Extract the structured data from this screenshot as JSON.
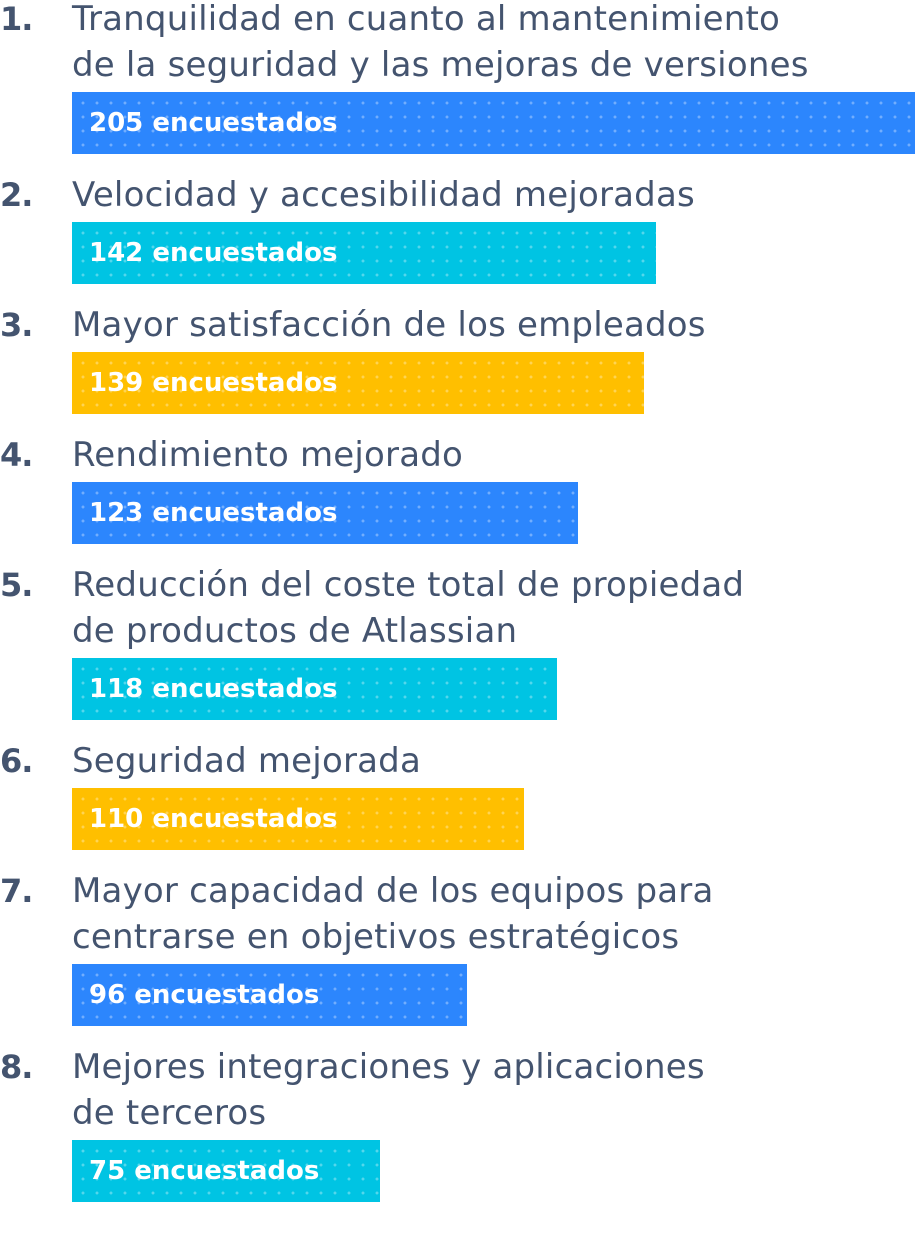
{
  "chart_data": {
    "type": "bar",
    "orientation": "horizontal",
    "value_suffix": "encuestados",
    "colors": {
      "blue": "#2c86fd",
      "cyan": "#00c4e3",
      "yellow": "#ffbf00",
      "text": "#44546f"
    },
    "items": [
      {
        "rank": "1.",
        "label_lines": [
          "Tranquilidad en cuanto al mantenimiento",
          "de la seguridad y las mejoras de versiones"
        ],
        "value": 205,
        "value_text": "205 encuestados",
        "color": "blue"
      },
      {
        "rank": "2.",
        "label_lines": [
          "Velocidad y accesibilidad mejoradas"
        ],
        "value": 142,
        "value_text": "142 encuestados",
        "color": "cyan"
      },
      {
        "rank": "3.",
        "label_lines": [
          "Mayor satisfacción de los empleados"
        ],
        "value": 139,
        "value_text": "139 encuestados",
        "color": "yellow"
      },
      {
        "rank": "4.",
        "label_lines": [
          "Rendimiento mejorado"
        ],
        "value": 123,
        "value_text": "123 encuestados",
        "color": "blue"
      },
      {
        "rank": "5.",
        "label_lines": [
          "Reducción del coste total de propiedad",
          "de productos de Atlassian"
        ],
        "value": 118,
        "value_text": "118 encuestados",
        "color": "cyan"
      },
      {
        "rank": "6.",
        "label_lines": [
          "Seguridad mejorada"
        ],
        "value": 110,
        "value_text": "110 encuestados",
        "color": "yellow"
      },
      {
        "rank": "7.",
        "label_lines": [
          "Mayor capacidad de los equipos para",
          "centrarse en objetivos estratégicos"
        ],
        "value": 96,
        "value_text": "96 encuestados",
        "color": "blue"
      },
      {
        "rank": "8.",
        "label_lines": [
          "Mejores integraciones y aplicaciones",
          "de terceros"
        ],
        "value": 75,
        "value_text": "75 encuestados",
        "color": "cyan"
      }
    ]
  }
}
